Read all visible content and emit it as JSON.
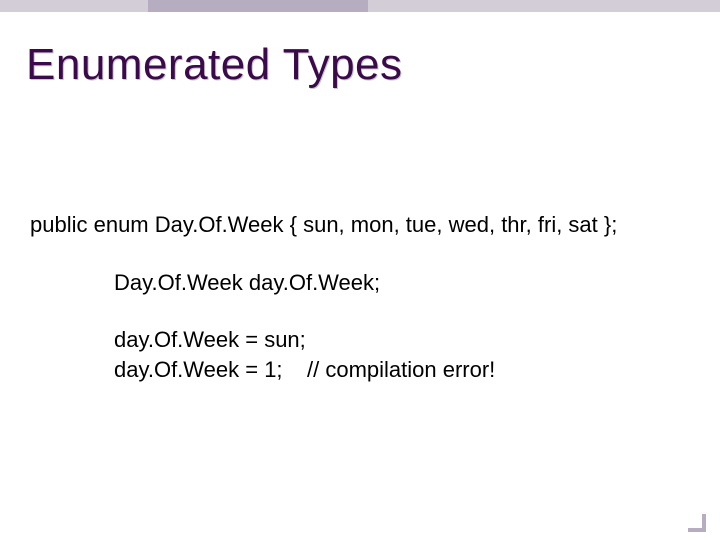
{
  "title": "Enumerated Types",
  "code": {
    "enum_decl": "public enum Day.Of.Week { sun, mon, tue, wed, thr, fri, sat };",
    "var_decl": "Day.Of.Week day.Of.Week;",
    "assign_valid": "day.Of.Week = sun;",
    "assign_error": "day.Of.Week = 1;",
    "error_comment": "// compilation error!"
  }
}
